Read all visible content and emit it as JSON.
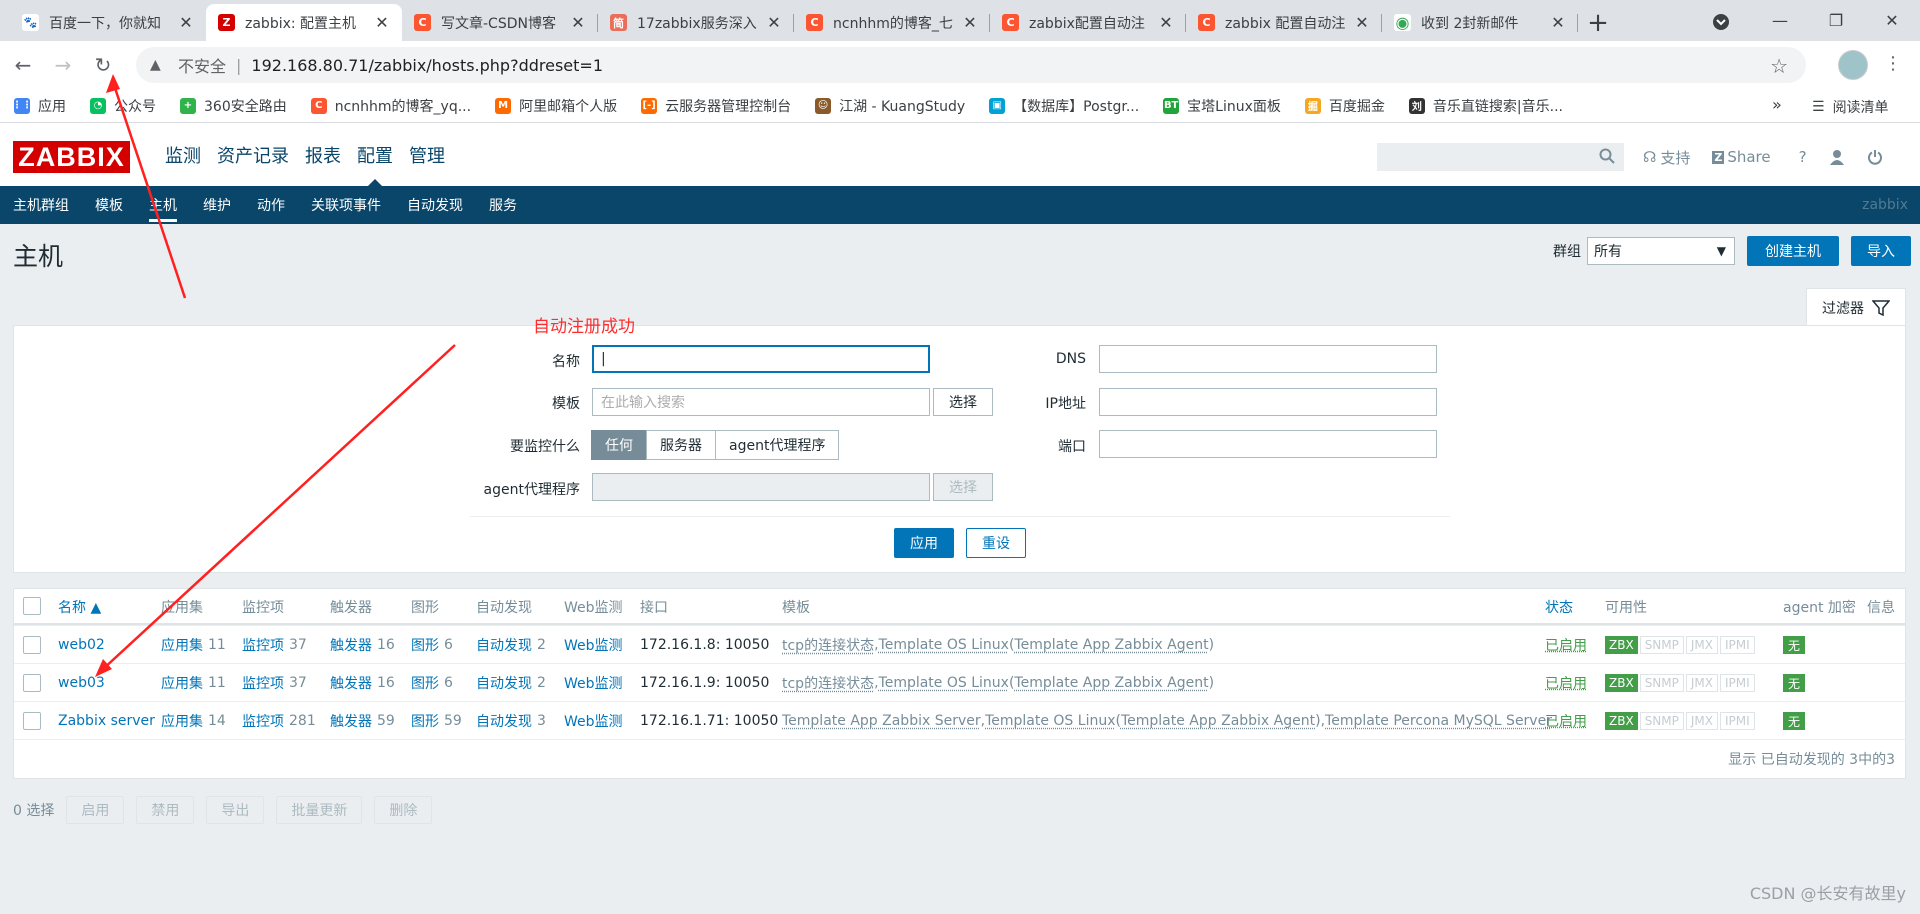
{
  "browser": {
    "tabs": [
      {
        "title": "百度一下，你就知",
        "icon": "baidu-paw-icon",
        "color": "#2932e1",
        "glyph": "🐾"
      },
      {
        "title": "zabbix: 配置主机",
        "icon": "zabbix-z-icon",
        "color": "#d40000",
        "glyph": "Z"
      },
      {
        "title": "写文章-CSDN博客",
        "icon": "csdn-c-icon",
        "color": "#fc5531",
        "glyph": "C"
      },
      {
        "title": "17zabbix服务深入",
        "icon": "jianshu-icon",
        "color": "#ea6f5a",
        "glyph": "简"
      },
      {
        "title": "ncnhhm的博客_七",
        "icon": "csdn-c-icon",
        "color": "#fc5531",
        "glyph": "C"
      },
      {
        "title": "zabbix配置自动注",
        "icon": "csdn-c-icon",
        "color": "#fc5531",
        "glyph": "C"
      },
      {
        "title": "zabbix 配置自动注",
        "icon": "csdn-c-icon",
        "color": "#fc5531",
        "glyph": "C"
      },
      {
        "title": "收到 2封新邮件",
        "icon": "mail-chrome-icon",
        "color": "#34a853",
        "glyph": "◉"
      }
    ],
    "active_tab": 1,
    "address": {
      "security": "不安全",
      "url": "192.168.80.71/zabbix/hosts.php?ddreset=1"
    },
    "bookmarks": [
      {
        "label": "应用",
        "icon": "apps-grid-icon",
        "color": "#4285f4",
        "glyph": "⋮⋮"
      },
      {
        "label": "公众号",
        "icon": "wechat-icon",
        "color": "#07c160",
        "glyph": "◔"
      },
      {
        "label": "360安全路由",
        "icon": "360-icon",
        "color": "#2fb34a",
        "glyph": "+"
      },
      {
        "label": "ncnhhm的博客_yq...",
        "icon": "csdn-c-icon",
        "color": "#fc5531",
        "glyph": "C"
      },
      {
        "label": "阿里邮箱个人版",
        "icon": "ali-mail-icon",
        "color": "#ff6a00",
        "glyph": "M"
      },
      {
        "label": "云服务器管理控制台",
        "icon": "aliyun-icon",
        "color": "#ff6a00",
        "glyph": "[-]"
      },
      {
        "label": "江湖 - KuangStudy",
        "icon": "kuang-avatar-icon",
        "color": "#8b5a2b",
        "glyph": "☺"
      },
      {
        "label": "【数据库】Postgr...",
        "icon": "bilibili-icon",
        "color": "#00a1d6",
        "glyph": "▣"
      },
      {
        "label": "宝塔Linux面板",
        "icon": "bt-panel-icon",
        "color": "#20a53a",
        "glyph": "BT"
      },
      {
        "label": "百度掘金",
        "icon": "juejin-icon",
        "color": "#f5a623",
        "glyph": "掘"
      },
      {
        "label": "音乐直链搜索|音乐...",
        "icon": "music-icon",
        "color": "#333333",
        "glyph": "刘"
      }
    ],
    "bookmarks_more": "»",
    "reading_list": "阅读清单"
  },
  "zabbix": {
    "logo": "ZABBIX",
    "main_menu": [
      "监测",
      "资产记录",
      "报表",
      "配置",
      "管理"
    ],
    "main_menu_selected": 3,
    "support": "支持",
    "share": "Share",
    "help": "?",
    "sub_menu": [
      "主机群组",
      "模板",
      "主机",
      "维护",
      "动作",
      "关联项事件",
      "自动发现",
      "服务"
    ],
    "sub_menu_selected": 2,
    "brand": "zabbix",
    "page_title": "主机",
    "group_label": "群组",
    "group_value": "所有",
    "create_host": "创建主机",
    "import": "导入",
    "filter_tab": "过滤器",
    "filter": {
      "name_label": "名称",
      "name_value": "",
      "template_label": "模板",
      "template_placeholder": "在此输入搜索",
      "select": "选择",
      "monitored_by_label": "要监控什么",
      "monitored_by": [
        "任何",
        "服务器",
        "agent代理程序"
      ],
      "proxy_label": "agent代理程序",
      "proxy_select": "选择",
      "dns_label": "DNS",
      "ip_label": "IP地址",
      "port_label": "端口",
      "apply": "应用",
      "reset": "重设"
    },
    "annotation": "自动注册成功",
    "columns": {
      "name": "名称 ▲",
      "apps": "应用集",
      "items": "监控项",
      "triggers": "触发器",
      "graphs": "图形",
      "discovery": "自动发现",
      "web": "Web监测",
      "interface": "接口",
      "templates": "模板",
      "status": "状态",
      "availability": "可用性",
      "encryption": "agent 加密",
      "info": "信息"
    },
    "rows": [
      {
        "name": "web02",
        "apps": "应用集",
        "apps_n": "11",
        "items": "监控项",
        "items_n": "37",
        "triggers": "触发器",
        "triggers_n": "16",
        "graphs": "图形",
        "graphs_n": "6",
        "discovery": "自动发现",
        "discovery_n": "2",
        "web": "Web监测",
        "interface": "172.16.1.8: 10050",
        "tpl": [
          {
            "t": "tcp的连接状态",
            "u": true
          },
          {
            "t": ", ",
            "u": false
          },
          {
            "t": "Template OS Linux",
            "u": true
          },
          {
            "t": " (",
            "u": false
          },
          {
            "t": "Template App Zabbix Agent",
            "u": true
          },
          {
            "t": ")",
            "u": false
          }
        ],
        "status": "已启用",
        "zbx": "ZBX",
        "snmp": "SNMP",
        "jmx": "JMX",
        "ipmi": "IPMI",
        "enc": "无"
      },
      {
        "name": "web03",
        "apps": "应用集",
        "apps_n": "11",
        "items": "监控项",
        "items_n": "37",
        "triggers": "触发器",
        "triggers_n": "16",
        "graphs": "图形",
        "graphs_n": "6",
        "discovery": "自动发现",
        "discovery_n": "2",
        "web": "Web监测",
        "interface": "172.16.1.9: 10050",
        "tpl": [
          {
            "t": "tcp的连接状态",
            "u": true
          },
          {
            "t": ", ",
            "u": false
          },
          {
            "t": "Template OS Linux",
            "u": true
          },
          {
            "t": " (",
            "u": false
          },
          {
            "t": "Template App Zabbix Agent",
            "u": true
          },
          {
            "t": ")",
            "u": false
          }
        ],
        "status": "已启用",
        "zbx": "ZBX",
        "snmp": "SNMP",
        "jmx": "JMX",
        "ipmi": "IPMI",
        "enc": "无"
      },
      {
        "name": "Zabbix server",
        "apps": "应用集",
        "apps_n": "14",
        "items": "监控项",
        "items_n": "281",
        "triggers": "触发器",
        "triggers_n": "59",
        "graphs": "图形",
        "graphs_n": "59",
        "discovery": "自动发现",
        "discovery_n": "3",
        "web": "Web监测",
        "interface": "172.16.1.71: 10050",
        "tpl": [
          {
            "t": "Template App Zabbix Server",
            "u": true
          },
          {
            "t": ", ",
            "u": false
          },
          {
            "t": "Template OS Linux",
            "u": true
          },
          {
            "t": " (",
            "u": false
          },
          {
            "t": "Template App Zabbix Agent",
            "u": true
          },
          {
            "t": "), ",
            "u": false
          },
          {
            "t": "Template Percona MySQL Server",
            "u": true
          }
        ],
        "status": "已启用",
        "zbx": "ZBX",
        "snmp": "SNMP",
        "jmx": "JMX",
        "ipmi": "IPMI",
        "enc": "无"
      }
    ],
    "paging": "显示 已自动发现的 3中的3",
    "selected_count": "0 选择",
    "mass_buttons": [
      "启用",
      "禁用",
      "导出",
      "批量更新",
      "删除"
    ]
  },
  "watermark": "CSDN @长安有故里y"
}
